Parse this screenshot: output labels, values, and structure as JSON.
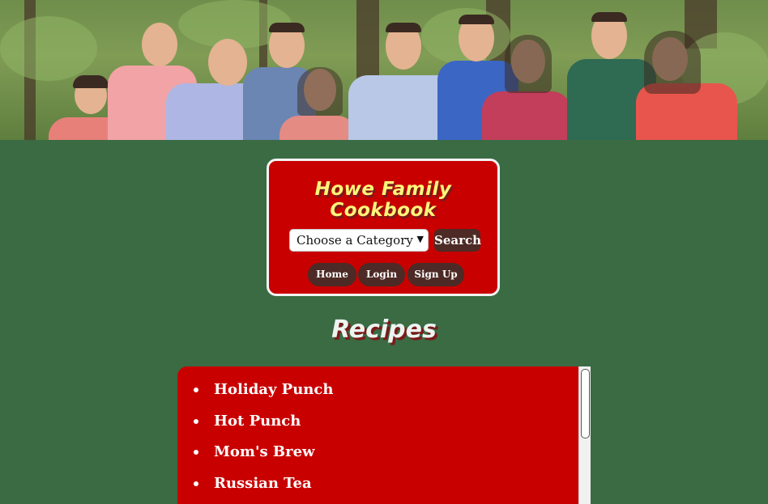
{
  "header": {
    "site_title": "Howe Family Cookbook",
    "category_select": {
      "selected": "Choose a Category"
    },
    "search_label": "Search",
    "nav": {
      "home": "Home",
      "login": "Login",
      "signup": "Sign Up"
    }
  },
  "main": {
    "heading": "Recipes",
    "recipes": [
      "Holiday Punch",
      "Hot Punch",
      "Mom's Brew",
      "Russian Tea"
    ]
  },
  "colors": {
    "page_background": "#3a6b43",
    "card_red": "#c90000",
    "button_brown": "#4d2a25",
    "title_yellow": "#fff57a"
  }
}
